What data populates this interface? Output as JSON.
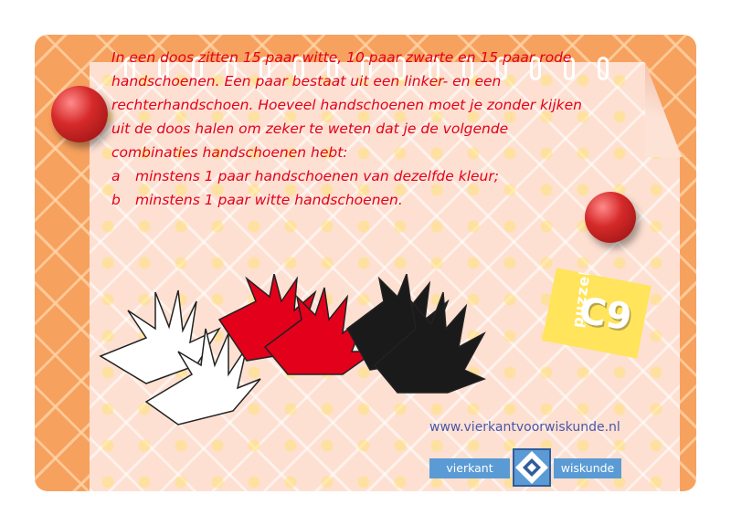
{
  "question": {
    "intro": "In een doos zitten 15 paar witte, 10 paar zwarte en 15 paar rode handschoenen. Een paar bestaat uit een linker- en een rechterhandschoen. Hoeveel handschoenen moet je zonder kijken uit de doos halen om zeker te weten dat je de volgende combinaties handschoenen hebt:",
    "options": [
      {
        "letter": "a",
        "text": "minstens 1 paar handschoenen van dezelfde kleur;"
      },
      {
        "letter": "b",
        "text": "minstens 1 paar witte handschoenen."
      }
    ]
  },
  "tag": {
    "word": "puzzel",
    "code": "C9"
  },
  "footer": {
    "url": "www.vierkantvoorwiskunde.nl"
  },
  "logo": {
    "left_text": "vierkant",
    "right_text": "wiskunde"
  },
  "colors": {
    "frame": "#f7a15f",
    "paper": "#fde0d2",
    "text": "#e3001b",
    "tag": "#ffe45c",
    "logo": "#5b9bd5",
    "url": "#4a56a8"
  },
  "illustration": [
    "white-gloves",
    "red-gloves",
    "black-gloves"
  ],
  "icons": [
    "push-pin-icon",
    "push-pin-icon",
    "logo-diamond-icon"
  ]
}
